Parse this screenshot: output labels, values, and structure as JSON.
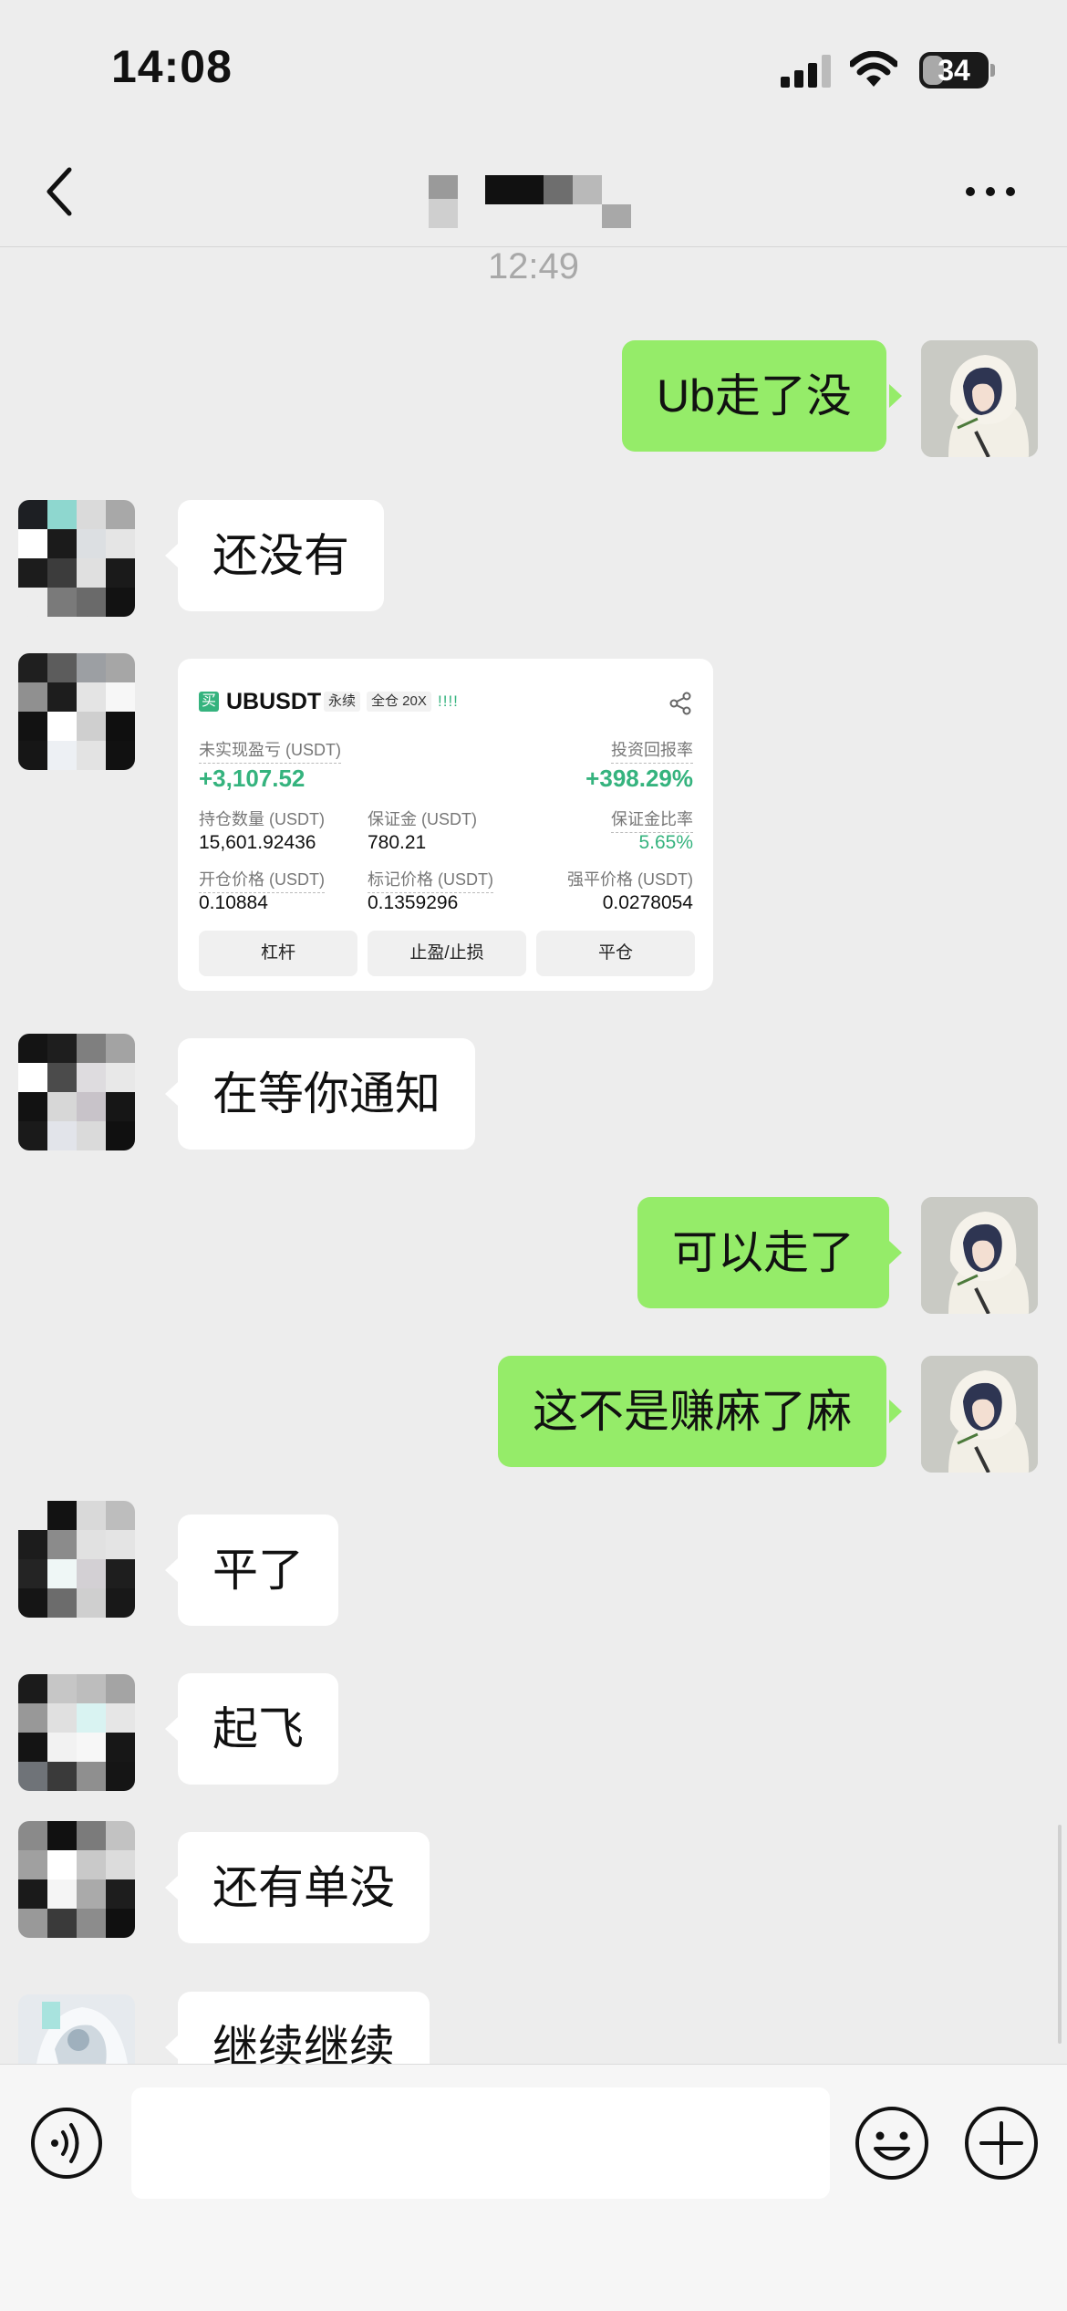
{
  "status_bar": {
    "time": "14:08",
    "battery": "34",
    "battery_level": 0.34
  },
  "header": {
    "back_icon": "chevron-left-icon",
    "more_icon": "more-horizontal-icon"
  },
  "timestamp": "12:49",
  "messages": [
    {
      "side": "right",
      "text": "Ub走了没"
    },
    {
      "side": "left",
      "text": "还没有"
    },
    {
      "side": "left",
      "type": "image"
    },
    {
      "side": "left",
      "text": "在等你通知"
    },
    {
      "side": "right",
      "text": "可以走了"
    },
    {
      "side": "right",
      "text": "这不是赚麻了麻"
    },
    {
      "side": "left",
      "text": "平了"
    },
    {
      "side": "left",
      "text": "起飞"
    },
    {
      "side": "left",
      "text": "还有单没"
    },
    {
      "side": "left",
      "text": "继续继续"
    }
  ],
  "trade_card": {
    "buy_badge": "买",
    "symbol": "UBUSDT",
    "perp": "永续",
    "mode": "全仓 20X",
    "signal": "!!!!",
    "unrealized_pnl_label": "未实现盈亏 (USDT)",
    "unrealized_pnl": "+3,107.52",
    "roi_label": "投资回报率",
    "roi": "+398.29%",
    "position_size_label": "持仓数量 (USDT)",
    "position_size": "15,601.92436",
    "margin_label": "保证金 (USDT)",
    "margin": "780.21",
    "margin_ratio_label": "保证金比率",
    "margin_ratio": "5.65%",
    "entry_price_label": "开仓价格 (USDT)",
    "entry_price": "0.10884",
    "mark_price_label": "标记价格 (USDT)",
    "mark_price": "0.1359296",
    "liq_price_label": "强平价格 (USDT)",
    "liq_price": "0.0278054",
    "buttons": [
      "杠杆",
      "止盈/止损",
      "平仓"
    ]
  },
  "input_bar": {
    "voice_icon": "voice-icon",
    "emoji_icon": "emoji-icon",
    "plus_icon": "plus-circle-icon"
  },
  "colors": {
    "self_bubble": "#95ec69",
    "other_bubble": "#ffffff",
    "background": "#ededed",
    "profit_green": "#35b37e"
  }
}
